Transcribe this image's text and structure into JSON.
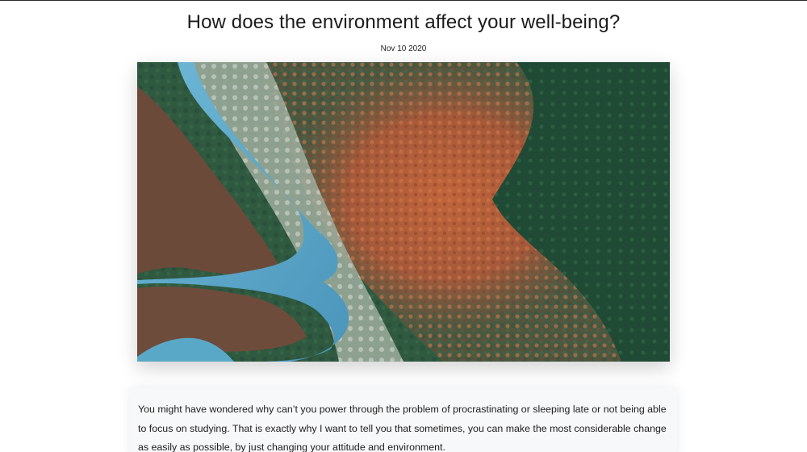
{
  "article": {
    "title": "How does the environment affect your well-being?",
    "date": "Nov 10 2020",
    "hero_image": {
      "icon": "aerial-forest-photo",
      "colors": {
        "river": "#5aa8c8",
        "pine": "#2f5a3f",
        "autumn": "#b55a35",
        "brown": "#6b4a3a",
        "frost": "#b8c2b4"
      }
    },
    "body": "You might have wondered why can’t you power through the problem of procrastinating or sleeping late or not being able to focus on studying. That is exactly why I want to tell you that sometimes, you can make the most considerable change as easily as possible, by just changing your attitude and environment."
  }
}
